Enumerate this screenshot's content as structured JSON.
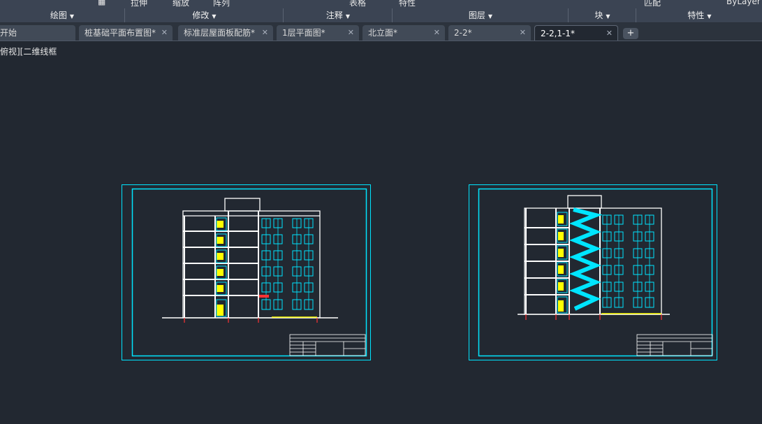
{
  "ribbon": {
    "top_fragments": [
      "拉伸",
      "缩放",
      "阵列",
      "表格",
      "特性",
      "匹配",
      "ByLayer"
    ],
    "panels": [
      {
        "label": "绘图"
      },
      {
        "label": "修改"
      },
      {
        "label": "注释"
      },
      {
        "label": "图层"
      },
      {
        "label": "块"
      },
      {
        "label": "特性"
      }
    ]
  },
  "tabs": [
    {
      "label": "开始"
    },
    {
      "label": "桩基础平面布置图*"
    },
    {
      "label": "标准层屋面板配筋*"
    },
    {
      "label": "1层平面图*"
    },
    {
      "label": "北立面*"
    },
    {
      "label": "2-2*"
    },
    {
      "label": "2-2,1-1*"
    }
  ],
  "viewport": {
    "label": "俯视][二维线框"
  },
  "colors": {
    "background": "#222831",
    "frame": "#00e5ff",
    "window": "#00e5ff",
    "stair": "#ffff00",
    "cut": "#ff3333"
  }
}
